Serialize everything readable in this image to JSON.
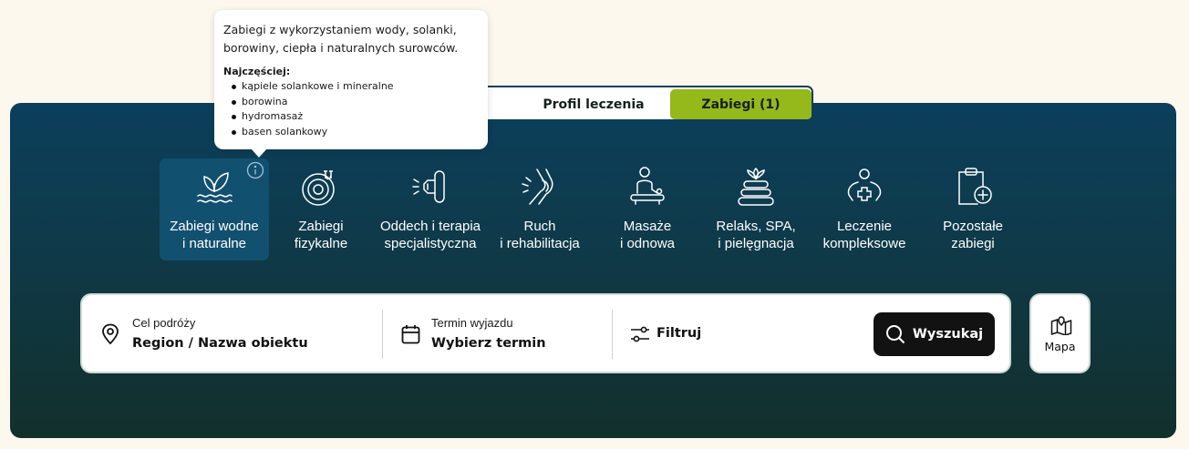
{
  "tabs": [
    {
      "label": "Profil leczenia",
      "active": false
    },
    {
      "label": "Zabiegi (1)",
      "active": true
    }
  ],
  "tooltip": {
    "description": "Zabiegi z wykorzystaniem wody, solanki, borowiny, ciepła i naturalnych surowców.",
    "most_label": "Najczęściej:",
    "items": [
      "kąpiele solankowe i mineralne",
      "borowina",
      "hydromasaż",
      "basen solankowy"
    ]
  },
  "categories": [
    {
      "line1": "Zabiegi wodne",
      "line2": "i naturalne",
      "icon": "leaf-water-icon",
      "active": true
    },
    {
      "line1": "Zabiegi",
      "line2": "fizykalne",
      "icon": "magnet-target-icon",
      "active": false
    },
    {
      "line1": "Oddech i terapia",
      "line2": "specjalistyczna",
      "icon": "inhaler-icon",
      "active": false
    },
    {
      "line1": "Ruch",
      "line2": "i rehabilitacja",
      "icon": "knee-joint-icon",
      "active": false
    },
    {
      "line1": "Masaże",
      "line2": "i odnowa",
      "icon": "massage-icon",
      "active": false
    },
    {
      "line1": "Relaks, SPA,",
      "line2": "i pielęgnacja",
      "icon": "spa-stones-icon",
      "active": false
    },
    {
      "line1": "Leczenie",
      "line2": "kompleksowe",
      "icon": "hands-cross-icon",
      "active": false
    },
    {
      "line1": "Pozostałe",
      "line2": "zabiegi",
      "icon": "clipboard-plus-icon",
      "active": false
    }
  ],
  "search": {
    "destination_label": "Cel podróży",
    "destination_value": "Region / Nazwa obiektu",
    "date_label": "Termin wyjazdu",
    "date_value": "Wybierz termin",
    "filter_label": "Filtruj",
    "search_button": "Wyszukaj"
  },
  "map_button": "Mapa",
  "colors": {
    "accent_green": "#95b81a",
    "panel_top": "#0b3f5c",
    "panel_bottom": "#12302c",
    "background": "#fcf8ee"
  }
}
